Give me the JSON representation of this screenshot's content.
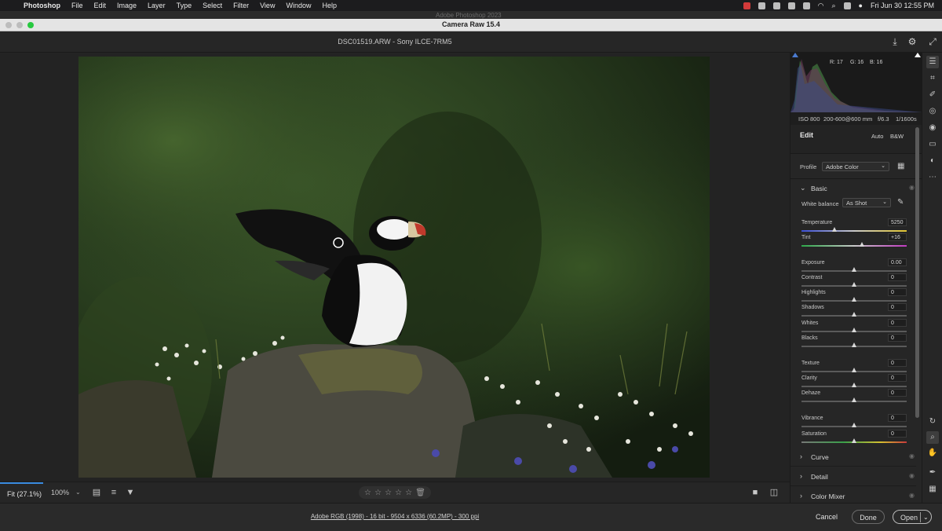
{
  "menubar": {
    "app": "Photoshop",
    "items": [
      "File",
      "Edit",
      "Image",
      "Layer",
      "Type",
      "Select",
      "Filter",
      "View",
      "Window",
      "Help"
    ],
    "clock": "Fri Jun 30  12:55 PM"
  },
  "background_window": {
    "title": "Adobe Photoshop 2023"
  },
  "window": {
    "title": "Camera Raw 15.4"
  },
  "file": {
    "name": "DSC01519.ARW  -  Sony ILCE-7RM5"
  },
  "histogram": {
    "r": "R: 17",
    "g": "G: 16",
    "b": "B: 16"
  },
  "exif": {
    "iso": "ISO 800",
    "lens": "200-600@600 mm",
    "aperture": "f/6.3",
    "shutter": "1/1600s"
  },
  "edit": {
    "title": "Edit",
    "auto": "Auto",
    "bw": "B&W"
  },
  "profile": {
    "label": "Profile",
    "value": "Adobe Color"
  },
  "basic": {
    "title": "Basic",
    "white_balance_label": "White balance",
    "white_balance_value": "As Shot",
    "sliders": [
      {
        "label": "Temperature",
        "value": "5250",
        "pos": 0.32
      },
      {
        "label": "Tint",
        "value": "+16",
        "pos": 0.58
      },
      {
        "label": "Exposure",
        "value": "0.00",
        "pos": 0.5
      },
      {
        "label": "Contrast",
        "value": "0",
        "pos": 0.5
      },
      {
        "label": "Highlights",
        "value": "0",
        "pos": 0.5
      },
      {
        "label": "Shadows",
        "value": "0",
        "pos": 0.5
      },
      {
        "label": "Whites",
        "value": "0",
        "pos": 0.5
      },
      {
        "label": "Blacks",
        "value": "0",
        "pos": 0.5
      },
      {
        "label": "Texture",
        "value": "0",
        "pos": 0.5
      },
      {
        "label": "Clarity",
        "value": "0",
        "pos": 0.5
      },
      {
        "label": "Dehaze",
        "value": "0",
        "pos": 0.5
      },
      {
        "label": "Vibrance",
        "value": "0",
        "pos": 0.5
      },
      {
        "label": "Saturation",
        "value": "0",
        "pos": 0.5
      }
    ]
  },
  "sections": [
    "Curve",
    "Detail",
    "Color Mixer"
  ],
  "bottom": {
    "fit": "Fit (27.1%)",
    "zoom": "100%"
  },
  "footer": {
    "info": "Adobe RGB (1998) - 16 bit - 9504 x 6336 (60.2MP) - 300 ppi",
    "cancel": "Cancel",
    "done": "Done",
    "open": "Open"
  }
}
